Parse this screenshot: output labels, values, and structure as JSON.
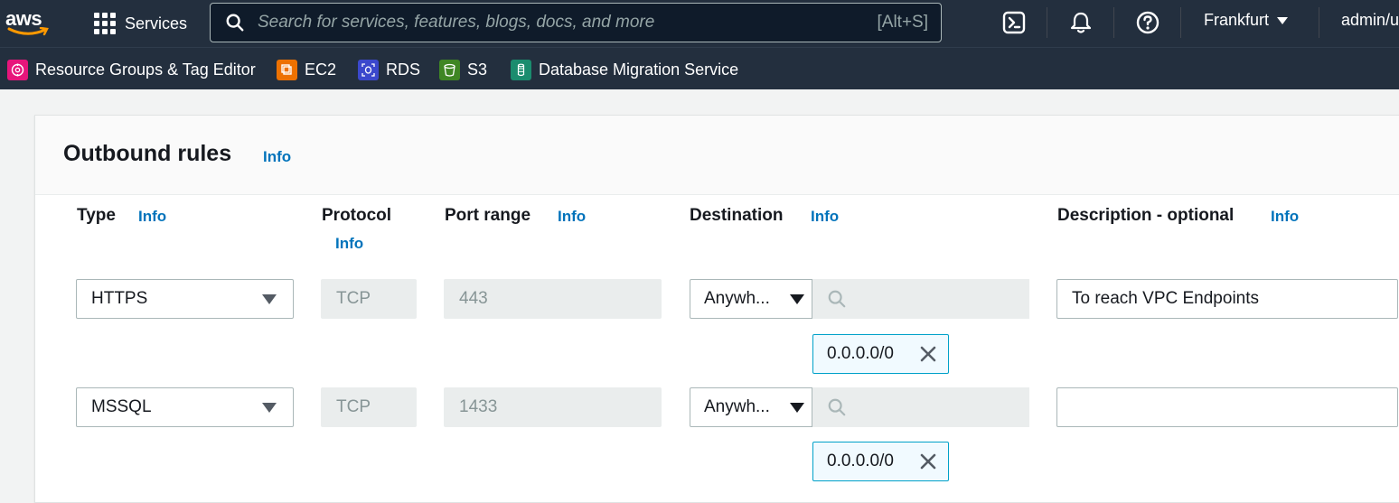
{
  "nav": {
    "logo": "aws",
    "services_label": "Services",
    "search_placeholder": "Search for services, features, blogs, docs, and more",
    "search_shortcut": "[Alt+S]",
    "region": "Frankfurt",
    "user": "admin/u",
    "icons": [
      "cloudshell-icon",
      "bell-icon",
      "help-icon"
    ]
  },
  "favorites": [
    {
      "label": "Resource Groups & Tag Editor",
      "icon": "resource-groups-icon",
      "color": "#e7157b"
    },
    {
      "label": "EC2",
      "icon": "ec2-icon",
      "color": "#ed7100"
    },
    {
      "label": "RDS",
      "icon": "rds-icon",
      "color": "#3b48cc"
    },
    {
      "label": "S3",
      "icon": "s3-icon",
      "color": "#3f8624"
    },
    {
      "label": "Database Migration Service",
      "icon": "dms-icon",
      "color": "#1b8c6e"
    }
  ],
  "panel": {
    "title": "Outbound rules",
    "info": "Info"
  },
  "columns": {
    "type": "Type",
    "protocol": "Protocol",
    "port_range": "Port range",
    "destination": "Destination",
    "description": "Description - optional",
    "info": "Info"
  },
  "rules": [
    {
      "type": "HTTPS",
      "protocol": "TCP",
      "port": "443",
      "destination": "Anywh...",
      "cidr": "0.0.0.0/0",
      "description": "To reach VPC Endpoints"
    },
    {
      "type": "MSSQL",
      "protocol": "TCP",
      "port": "1433",
      "destination": "Anywh...",
      "cidr": "0.0.0.0/0",
      "description": ""
    }
  ],
  "colors": {
    "nav_bg": "#232f3e",
    "link": "#0073bb",
    "token_border": "#00a1c9"
  }
}
